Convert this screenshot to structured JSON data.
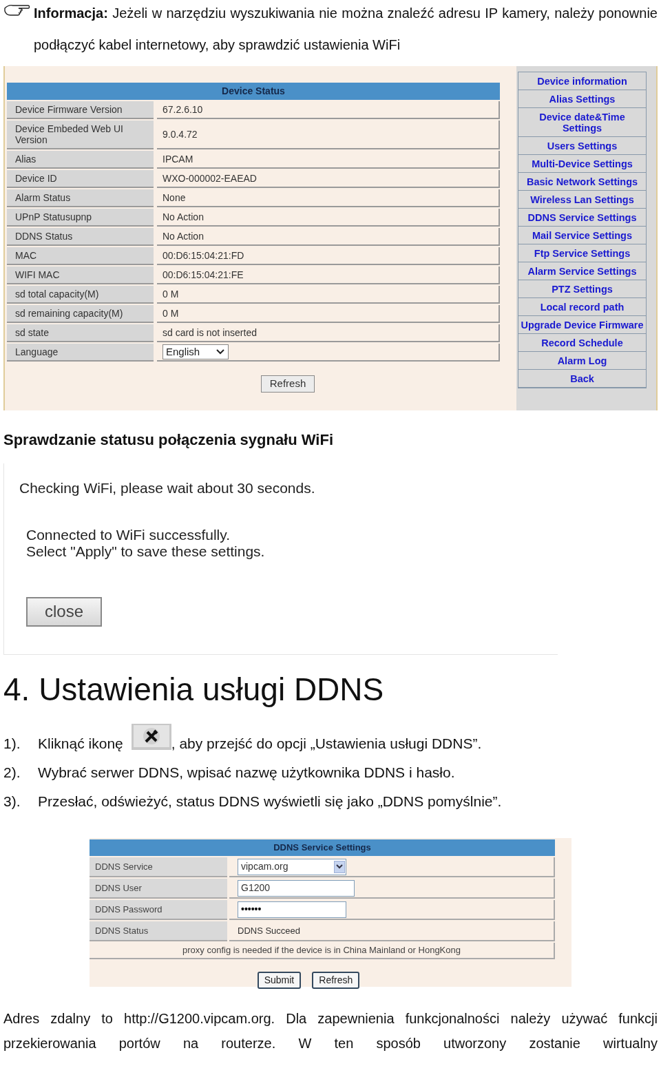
{
  "note": {
    "text": "**Informacja:** Jeżeli w narzędziu wyszukiwania nie można znaleźć adresu IP kamery, należy ponownie podłączyć kabel internetowy, aby sprawdzić ustawienia WiFi"
  },
  "device_status": {
    "title": "Device Status",
    "rows": [
      {
        "kind": "text",
        "label": "Device Firmware Version",
        "value": "67.2.6.10"
      },
      {
        "kind": "text",
        "label": "Device Embeded Web UI Version",
        "value": "9.0.4.72"
      },
      {
        "kind": "text",
        "label": "Alias",
        "value": "IPCAM"
      },
      {
        "kind": "text",
        "label": "Device ID",
        "value": "WXO-000002-EAEAD"
      },
      {
        "kind": "text",
        "label": "Alarm Status",
        "value": "None"
      },
      {
        "kind": "text",
        "label": "UPnP Statusupnp",
        "value": "No Action"
      },
      {
        "kind": "text",
        "label": "DDNS Status",
        "value": "No Action"
      },
      {
        "kind": "text",
        "label": "MAC",
        "value": "00:D6:15:04:21:FD"
      },
      {
        "kind": "text",
        "label": "WIFI MAC",
        "value": "00:D6:15:04:21:FE"
      },
      {
        "kind": "text",
        "label": "sd total capacity(M)",
        "value": "0 M"
      },
      {
        "kind": "text",
        "label": "sd remaining capacity(M)",
        "value": "0 M"
      },
      {
        "kind": "text",
        "label": "sd state",
        "value": "sd card is not inserted"
      },
      {
        "kind": "select",
        "label": "Language",
        "value": "English"
      }
    ],
    "refresh_button": "Refresh",
    "menu": [
      "Device information",
      "Alias Settings",
      "Device date&Time Settings",
      "Users Settings",
      "Multi-Device Settings",
      "Basic Network Settings",
      "Wireless Lan Settings",
      "DDNS Service Settings",
      "Mail Service Settings",
      "Ftp Service Settings",
      "Alarm Service Settings",
      "PTZ Settings",
      "Local record path",
      "Upgrade Device Firmware",
      "Record Schedule",
      "Alarm Log",
      "Back"
    ]
  },
  "wifi_heading": "Sprawdzanie statusu połączenia sygnału WiFi",
  "wifi_dialog": {
    "checking": "Checking WiFi, please wait about 30 seconds.",
    "result_lines": [
      "Connected to WiFi successfully.",
      "Select \"Apply\" to save these settings."
    ],
    "close_button": "close"
  },
  "section_heading": "4. Ustawienia usługi DDNS",
  "steps": [
    {
      "number": "1).",
      "before": "Kliknąć ikonę",
      "after": ", aby przejść do opcji „Ustawienia usługi DDNS”."
    },
    {
      "number": "2).",
      "before": "Wybrać serwer DDNS, wpisać nazwę użytkownika DDNS i hasło."
    },
    {
      "number": "3).",
      "before": "Przesłać, odświeżyć, status DDNS wyświetli się jako „DDNS pomyślnie”."
    }
  ],
  "ddns": {
    "title": "DDNS Service Settings",
    "rows": [
      {
        "kind": "select",
        "label": "DDNS Service",
        "value": "vipcam.org"
      },
      {
        "kind": "input",
        "label": "DDNS User",
        "value": "G1200"
      },
      {
        "kind": "password",
        "label": "DDNS Password",
        "value": "••••••"
      },
      {
        "kind": "text",
        "label": "DDNS Status",
        "value": "DDNS Succeed"
      }
    ],
    "notice": "proxy config is needed if the device is in China Mainland or HongKong",
    "buttons": [
      "Submit",
      "Refresh"
    ]
  },
  "footer_paragraph": "Adres zdalny to http://G1200.vipcam.org. Dla zapewnienia funkcjonalności należy używać funkcji przekierowania portów na routerze. W ten sposób utworzony zostanie wirtualny"
}
